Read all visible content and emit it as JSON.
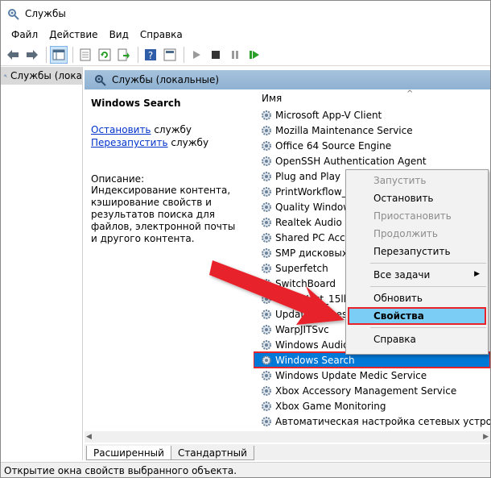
{
  "window": {
    "title": "Службы"
  },
  "menu": [
    "Файл",
    "Действие",
    "Вид",
    "Справка"
  ],
  "toolbar": {
    "buttons": [
      "back-icon",
      "forward-icon",
      "console-tree-icon",
      "properties-icon",
      "refresh-icon",
      "export-icon",
      "help-icon",
      "mmc-icon",
      "play-icon",
      "stop-icon",
      "pause-icon",
      "resume-icon"
    ]
  },
  "tree": {
    "root_label": "Службы (лока"
  },
  "pane": {
    "header": "Службы (локальные)",
    "selected_service": "Windows Search",
    "link_stop": "Остановить",
    "link_stop_suffix": " службу",
    "link_restart": "Перезапустить",
    "link_restart_suffix": " службу",
    "desc_label": "Описание:",
    "desc_text": "Индексирование контента, кэширование свойств и результатов поиска для файлов, электронной почты и другого контента."
  },
  "list": {
    "column_name": "Имя",
    "rows": [
      "Microsoft App-V Client",
      "Mozilla Maintenance Service",
      "Office 64 Source Engine",
      "OpenSSH Authentication Agent",
      "Plug and Play",
      "PrintWorkflow_15",
      "Quality Windows",
      "Realtek Audio Se",
      "Shared PC Accou",
      "SMP дисковых п",
      "Superfetch",
      "SwitchBoard",
      "Sync Host_15ll",
      "Update Orchestr",
      "WarpJITSvc",
      "Windows Audio",
      "Windows Search",
      "Windows Update Medic Service",
      "Xbox Accessory Management Service",
      "Xbox Game Monitoring",
      "Автоматическая настройка сетевых устройств"
    ],
    "selected_index": 16
  },
  "context_menu": {
    "items": [
      {
        "label": "Запустить",
        "state": "disabled"
      },
      {
        "label": "Остановить",
        "state": "normal"
      },
      {
        "label": "Приостановить",
        "state": "disabled"
      },
      {
        "label": "Продолжить",
        "state": "disabled"
      },
      {
        "label": "Перезапустить",
        "state": "normal"
      },
      {
        "label": "Все задачи",
        "state": "submenu"
      },
      {
        "label": "Обновить",
        "state": "normal"
      },
      {
        "label": "Свойства",
        "state": "highlight"
      },
      {
        "label": "Справка",
        "state": "normal"
      }
    ]
  },
  "tabs": [
    "Расширенный",
    "Стандартный"
  ],
  "status": "Открытие окна свойств выбранного объекта.",
  "colors": {
    "selection": "#0078d7",
    "highlight_menu": "#7ccdf5",
    "annotation_red": "#e8232a",
    "header_blue": "#9dbbd8"
  }
}
